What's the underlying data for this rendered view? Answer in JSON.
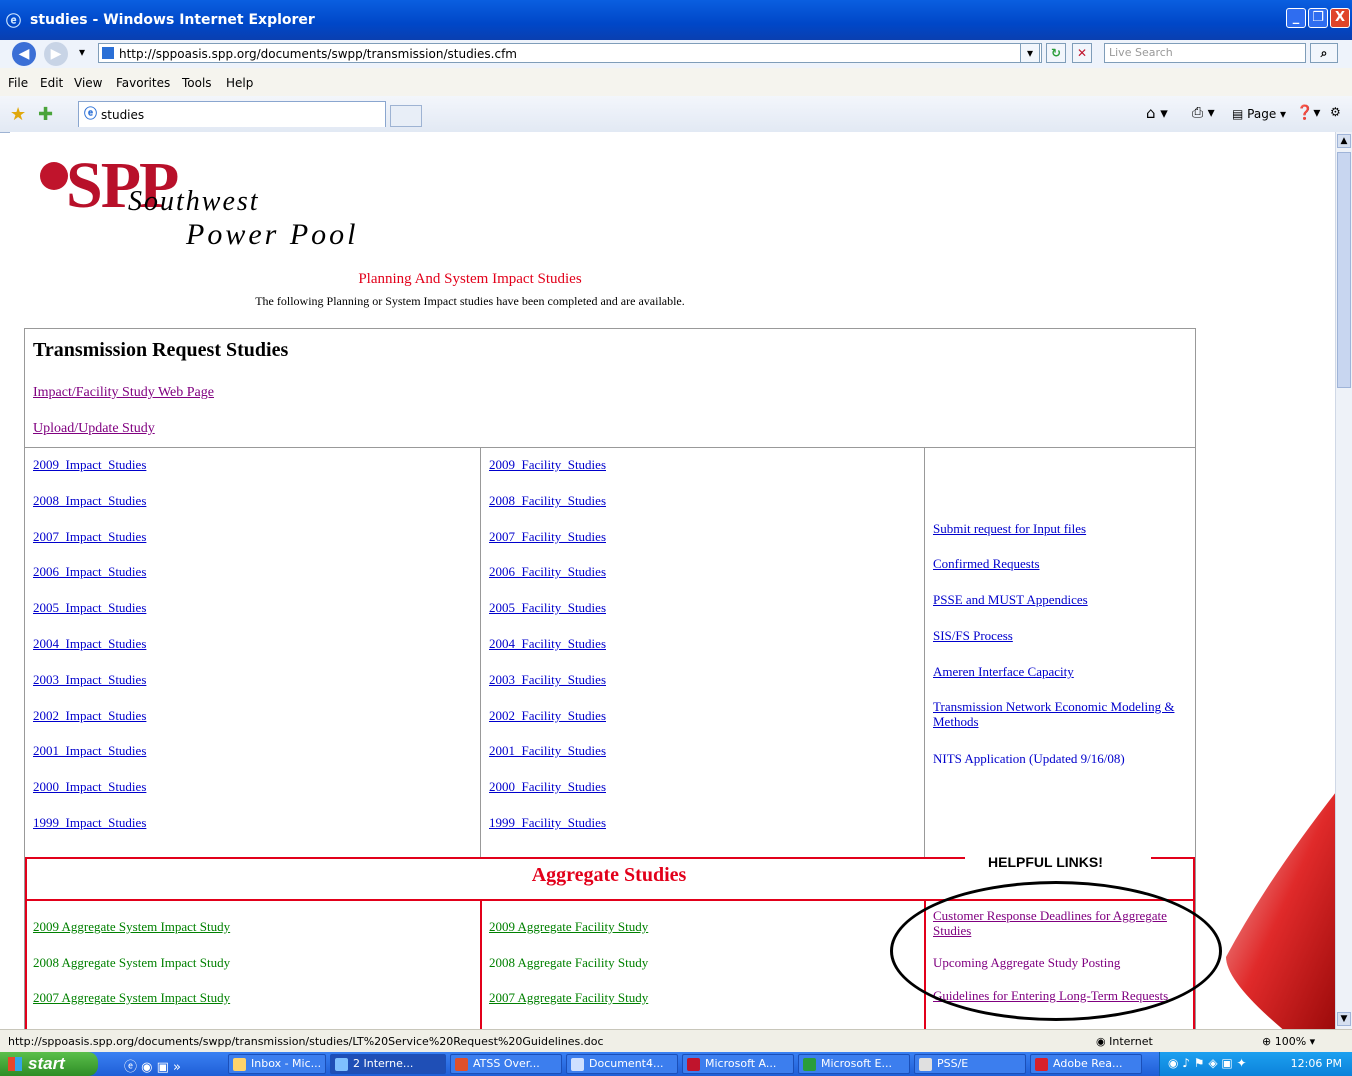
{
  "window": {
    "title": "studies - Windows Internet Explorer",
    "minimize": "_",
    "maximize": "❐",
    "close": "X"
  },
  "address": {
    "url": "http://sppoasis.spp.org/documents/swpp/transmission/studies.cfm",
    "search_placeholder": "Live Search"
  },
  "menu": [
    "File",
    "Edit",
    "View",
    "Favorites",
    "Tools",
    "Help"
  ],
  "tab": {
    "label": "studies"
  },
  "commandbar": {
    "page_label": "Page"
  },
  "logo": {
    "spp": "SPP",
    "line1": "Southwest",
    "line2": "Power Pool"
  },
  "page": {
    "heading": "Planning And System Impact Studies",
    "subheading": "The following Planning or System Impact studies have been completed and are available."
  },
  "transmission": {
    "title": "Transmission Request Studies",
    "top_links": [
      "Impact/Facility Study Web Page",
      "Upload/Update Study"
    ],
    "impact_studies": [
      "2009_Impact_Studies",
      "2008_Impact_Studies",
      "2007_Impact_Studies",
      "2006_Impact_Studies",
      "2005_Impact_Studies",
      "2004_Impact_Studies",
      "2003_Impact_Studies",
      "2002_Impact_Studies",
      "2001_Impact_Studies",
      "2000_Impact_Studies",
      "1999_Impact_Studies"
    ],
    "facility_studies": [
      "2009_Facility_Studies",
      "2008_Facility_Studies",
      "2007_Facility_Studies",
      "2006_Facility_Studies",
      "2005_Facility_Studies",
      "2004_Facility_Studies",
      "2003_Facility_Studies",
      "2002_Facility_Studies",
      "2001_Facility_Studies",
      "2000_Facility_Studies",
      "1999_Facility_Studies"
    ],
    "side_links": [
      "Submit request for Input files",
      "Confirmed Requests",
      "PSSE and MUST Appendices",
      "SIS/FS Process",
      "Ameren Interface Capacity",
      "Transmission Network Economic Modeling & Methods",
      "NITS Application (Updated 9/16/08)"
    ]
  },
  "aggregate": {
    "title": "Aggregate Studies",
    "helpful_label": "HELPFUL LINKS!",
    "impact": [
      "2009 Aggregate System Impact Study",
      "2008 Aggregate System Impact Study",
      "2007 Aggregate System Impact Study"
    ],
    "facility": [
      "2009 Aggregate Facility Study",
      "2008 Aggregate Facility Study",
      "2007 Aggregate Facility Study"
    ],
    "side_links": [
      "Customer Response Deadlines for Aggregate Studies",
      "Upcoming Aggregate Study Posting",
      "Guidelines for Entering Long-Term Requests"
    ]
  },
  "status": {
    "url": "http://sppoasis.spp.org/documents/swpp/transmission/studies/LT%20Service%20Request%20Guidelines.doc",
    "zone": "Internet",
    "zoom": "100%"
  },
  "taskbar": {
    "start": "start",
    "tasks": [
      "Inbox - Mic...",
      "2 Interne...",
      "ATSS Over...",
      "Document4...",
      "Microsoft A...",
      "Microsoft E...",
      "PSS/E",
      "Adobe Rea..."
    ],
    "clock": "12:06 PM"
  },
  "colors": {
    "heading_red": "#e2001a",
    "link_blue": "#0000cc",
    "visited_purple": "#800080",
    "aggregate_green": "#008000",
    "logo_red": "#b8102a"
  }
}
